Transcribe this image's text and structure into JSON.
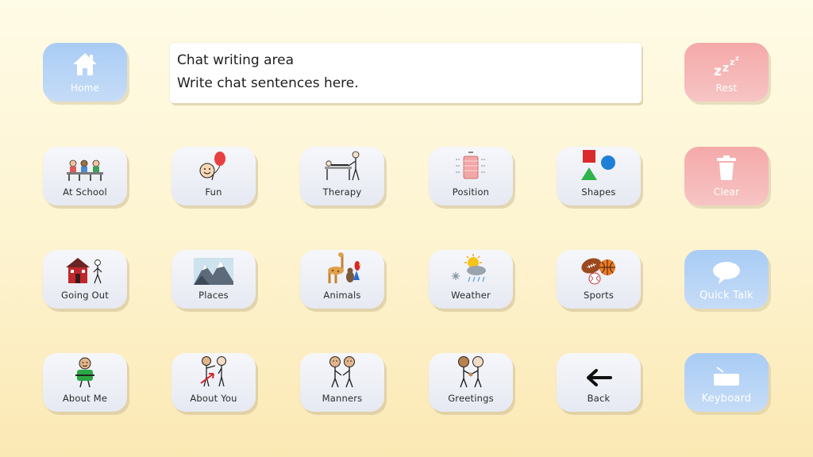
{
  "chat": {
    "title": "Chat writing area",
    "placeholder": "Write chat sentences here."
  },
  "side_buttons": {
    "home": "Home",
    "rest": "Rest",
    "clear": "Clear",
    "quick_talk": "Quick Talk",
    "keyboard": "Keyboard"
  },
  "categories": {
    "at_school": "At School",
    "fun": "Fun",
    "therapy": "Therapy",
    "position": "Position",
    "shapes": "Shapes",
    "going_out": "Going Out",
    "places": "Places",
    "animals": "Animals",
    "weather": "Weather",
    "sports": "Sports",
    "about_me": "About Me",
    "about_you": "About You",
    "manners": "Manners",
    "greetings": "Greetings",
    "back": "Back"
  },
  "icons": {
    "home": "house-icon",
    "rest": "zzz-icon",
    "clear": "trash-icon",
    "quick_talk": "speech-bubble-icon",
    "keyboard": "keyboard-icon",
    "at_school": "students-at-desks-icon",
    "fun": "balloon-icon",
    "therapy": "therapy-table-icon",
    "position": "position-icon",
    "shapes": "shapes-icon",
    "going_out": "house-walker-icon",
    "places": "mountains-icon",
    "animals": "giraffe-parrot-icon",
    "weather": "sun-cloud-snow-icon",
    "sports": "balls-icon",
    "about_me": "person-self-icon",
    "about_you": "person-pointing-icon",
    "manners": "two-people-icon",
    "greetings": "handshake-icon",
    "back": "left-arrow-icon"
  },
  "colors": {
    "background_top": "#fefbe6",
    "background_bottom": "#fbe9b4",
    "tile": "#eef0f6",
    "blue_tile": "#a9ccf5",
    "red_tile": "#f5a9a9"
  }
}
